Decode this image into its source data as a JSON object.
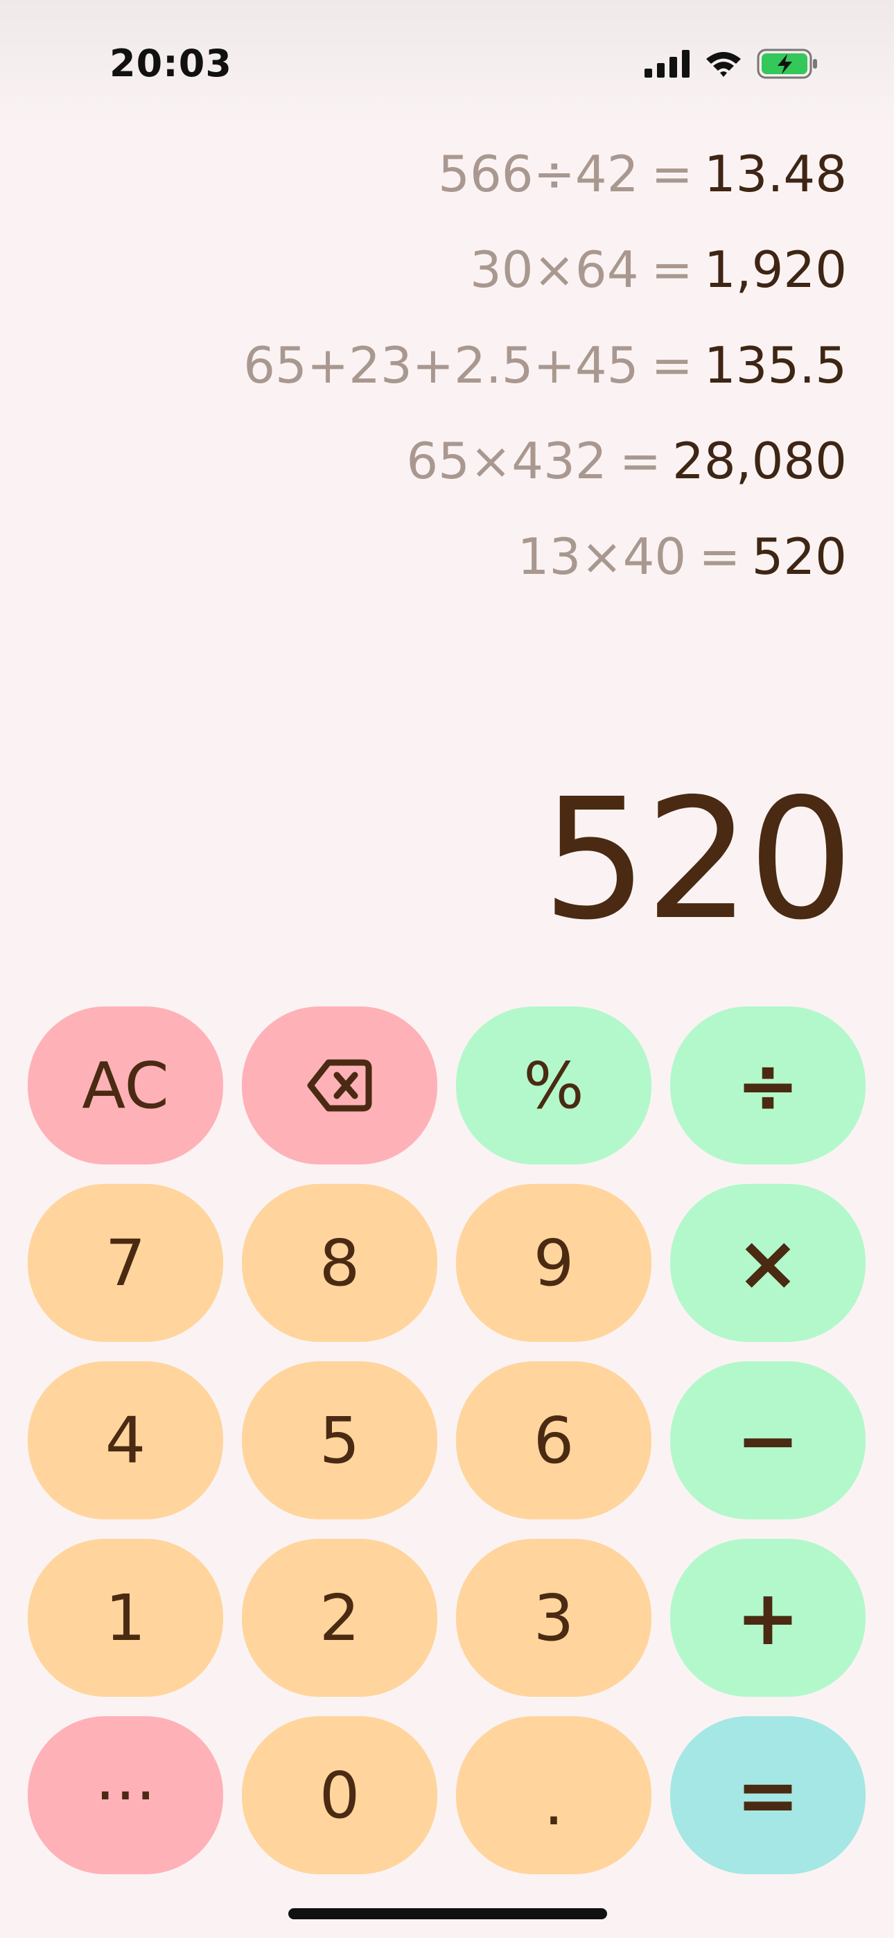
{
  "status_bar": {
    "time": "20:03",
    "icons": [
      "cellular-signal-icon",
      "wifi-icon",
      "battery-charging-icon"
    ]
  },
  "history": [
    {
      "expression": "566÷42",
      "equals": "=",
      "result": "13.48"
    },
    {
      "expression": "30×64",
      "equals": "=",
      "result": "1,920"
    },
    {
      "expression": "65+23+2.5+45",
      "equals": "=",
      "result": "135.5"
    },
    {
      "expression": "65×432",
      "equals": "=",
      "result": "28,080"
    },
    {
      "expression": "13×40",
      "equals": "=",
      "result": "520"
    }
  ],
  "display": {
    "value": "520"
  },
  "keypad": {
    "clear": "AC",
    "backspace_icon": "backspace-icon",
    "percent": "%",
    "divide": "÷",
    "seven": "7",
    "eight": "8",
    "nine": "9",
    "multiply": "×",
    "four": "4",
    "five": "5",
    "six": "6",
    "minus": "−",
    "one": "1",
    "two": "2",
    "three": "3",
    "plus": "+",
    "more": "···",
    "zero": "0",
    "decimal": ".",
    "equals": "="
  },
  "colors": {
    "background": "#fbf3f3",
    "function_key": "#ffb1b8",
    "digit_key": "#ffd59d",
    "operator_key": "#b3f8cb",
    "equals_key": "#a5e7e4",
    "text": "#4a2a12",
    "history_expression": "#a99890"
  }
}
